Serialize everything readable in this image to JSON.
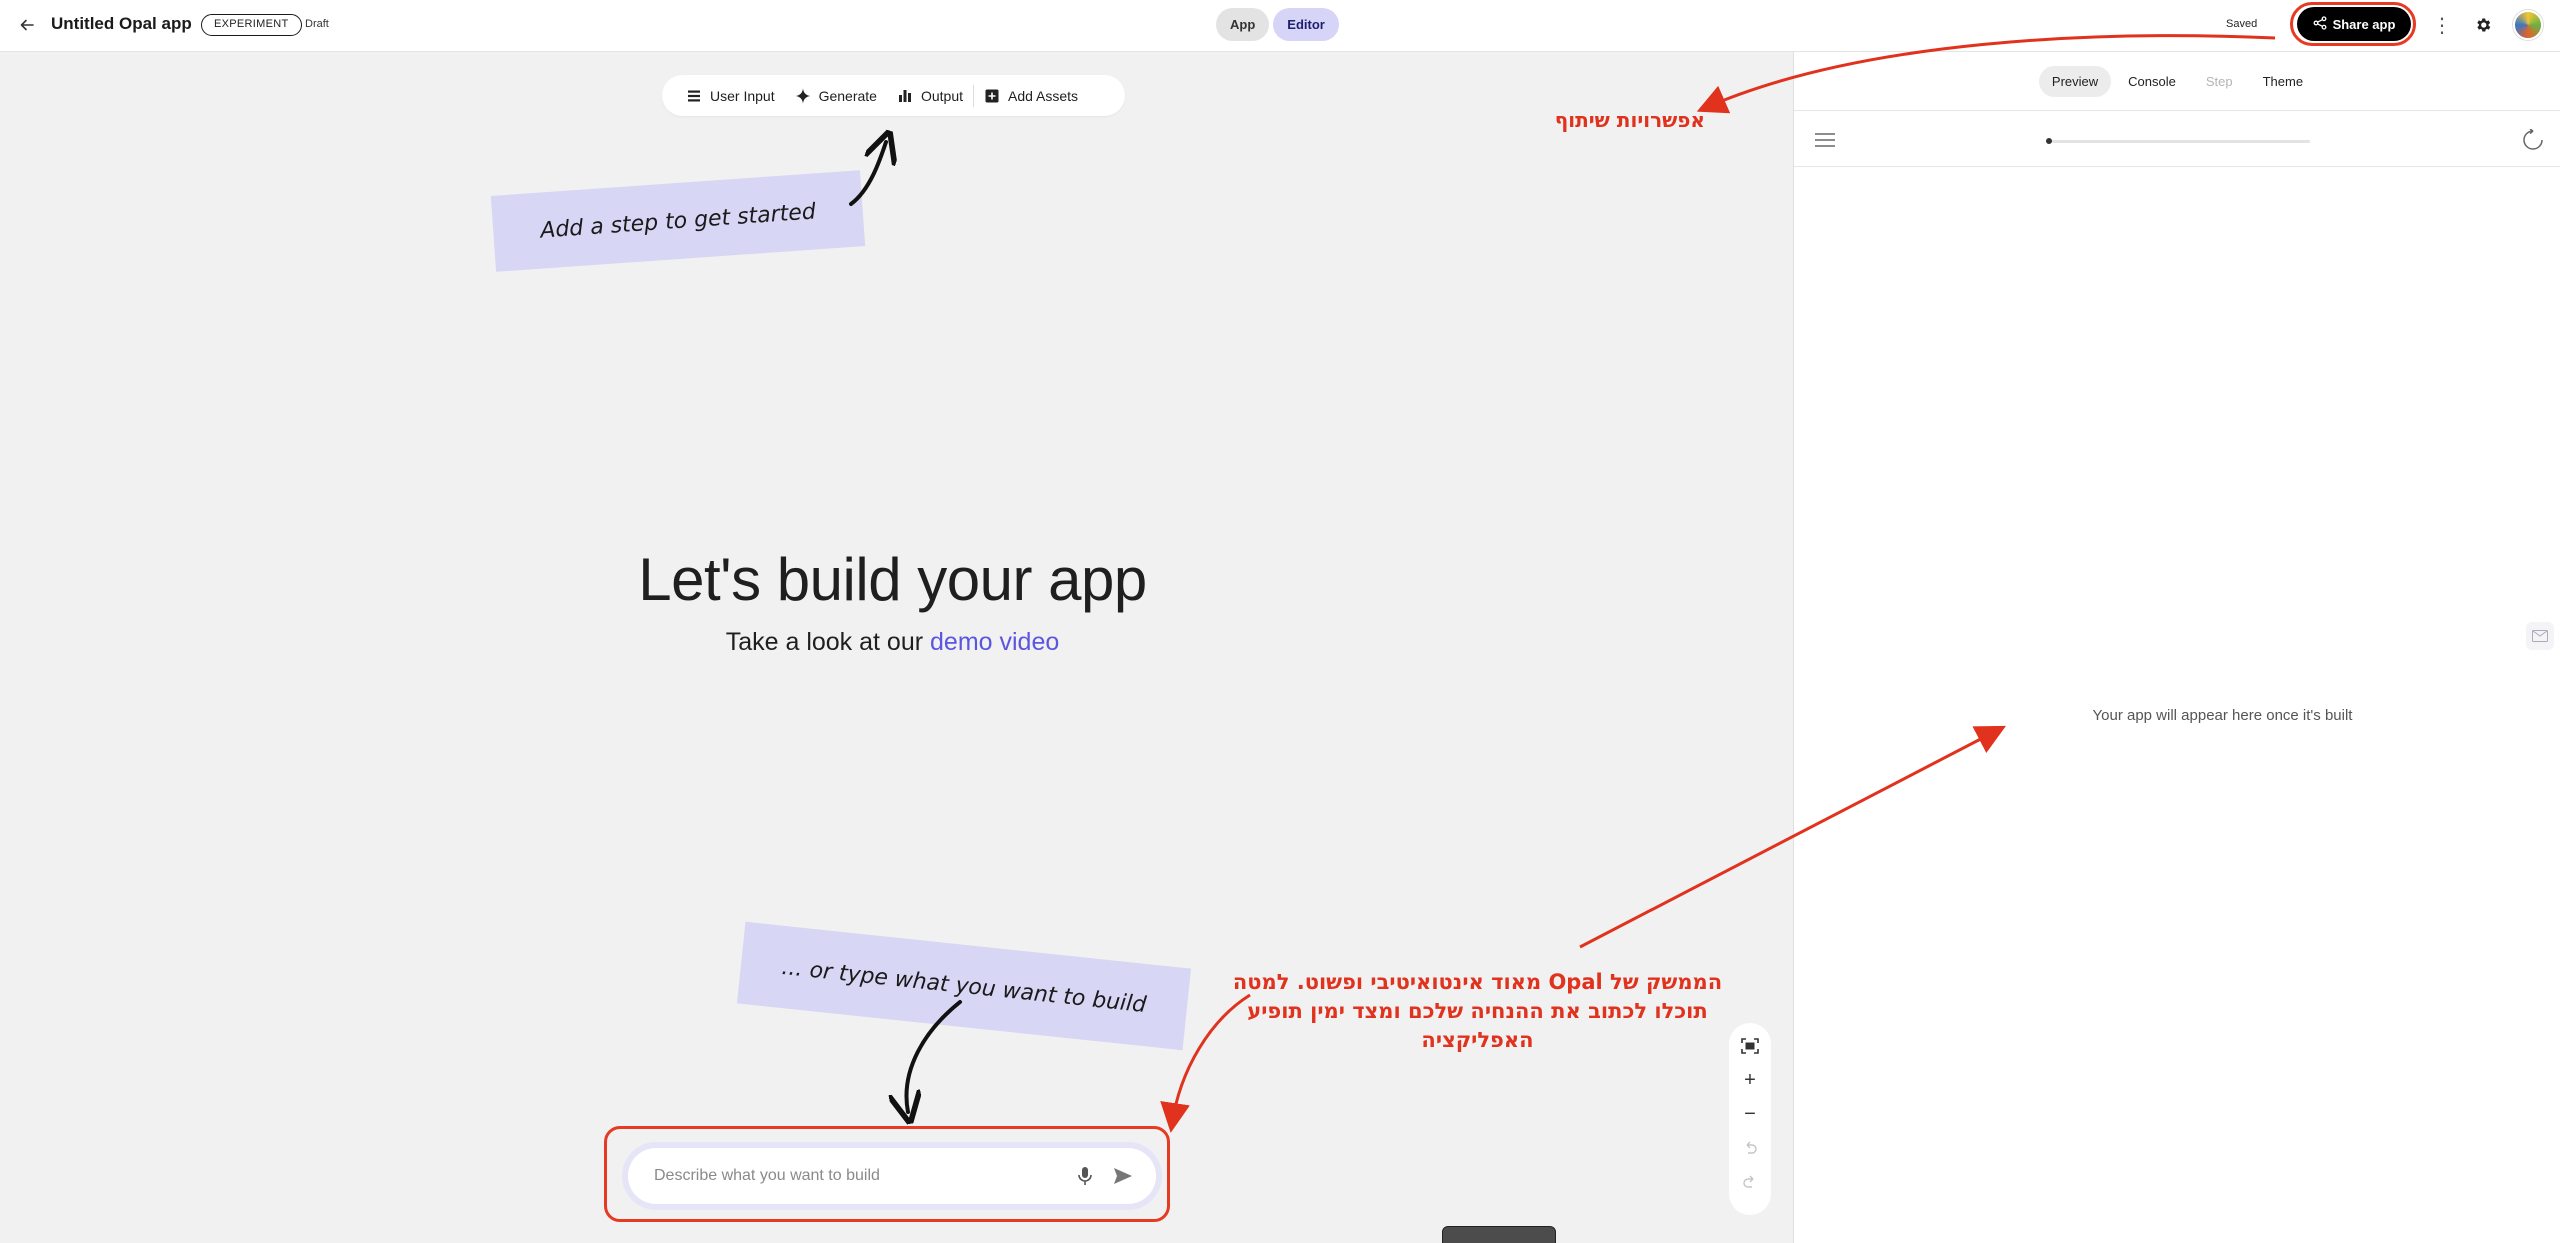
{
  "header": {
    "app_title": "Untitled Opal app",
    "experiment_badge": "EXPERIMENT",
    "status": "Draft",
    "mode_app": "App",
    "mode_editor": "Editor",
    "saved": "Saved",
    "share_label": "Share app"
  },
  "toolbar": {
    "items": [
      {
        "label": "User Input",
        "icon": "list-icon"
      },
      {
        "label": "Generate",
        "icon": "sparkle-icon"
      },
      {
        "label": "Output",
        "icon": "bar-chart-icon"
      },
      {
        "label": "Add Assets",
        "icon": "add-box-icon"
      }
    ]
  },
  "canvas": {
    "note_top": "Add a step to get started",
    "note_bottom": "... or type what you want to build",
    "hero_title": "Let's build your app",
    "hero_sub_prefix": "Take a look at our",
    "hero_sub_link": "demo video",
    "prompt_placeholder": "Describe what you want to build"
  },
  "panel": {
    "tabs": [
      "Preview",
      "Console",
      "Step",
      "Theme"
    ],
    "active_tab": "Preview",
    "empty_message": "Your app will appear here once it's built",
    "progress": 0.0
  },
  "annotations": {
    "share_note": "אפשרויות שיתוף",
    "main_note_line1": "הממשק של Opal מאוד אינטואיטיבי ופשוט. למטה",
    "main_note_line2": "תוכלו לכתוב את ההנחיה שלכם ומצד ימין תופיע",
    "main_note_line3": "האפליקציה"
  },
  "colors": {
    "accent": "#5b55e0",
    "annotation": "#e0321c",
    "note_bg": "#d7d6f4",
    "editor_pill": "#d6d4f7"
  }
}
